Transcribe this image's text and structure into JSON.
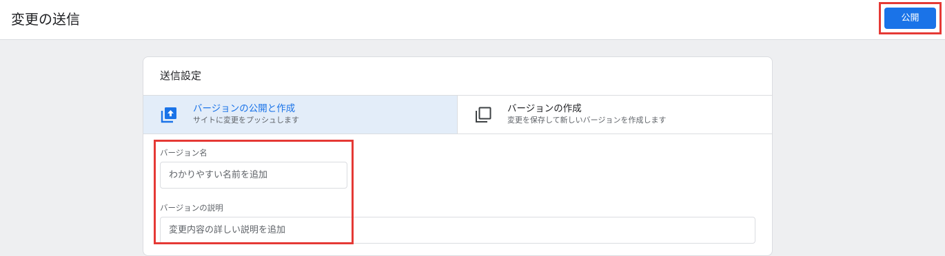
{
  "header": {
    "title": "変更の送信",
    "publish_label": "公開"
  },
  "card": {
    "title": "送信設定",
    "options": [
      {
        "title": "バージョンの公開と作成",
        "subtitle": "サイトに変更をプッシュします",
        "icon": "publish-upload-icon",
        "selected": true
      },
      {
        "title": "バージョンの作成",
        "subtitle": "変更を保存して新しいバージョンを作成します",
        "icon": "copy-stack-icon",
        "selected": false
      }
    ],
    "fields": {
      "version_name_label": "バージョン名",
      "version_name_placeholder": "わかりやすい名前を追加",
      "version_desc_label": "バージョンの説明",
      "version_desc_placeholder": "変更内容の詳しい説明を追加"
    }
  },
  "colors": {
    "accent": "#1a73e8",
    "selected_bg": "#e3edf9",
    "highlight": "#e53935",
    "page_bg": "#eeeff1"
  }
}
